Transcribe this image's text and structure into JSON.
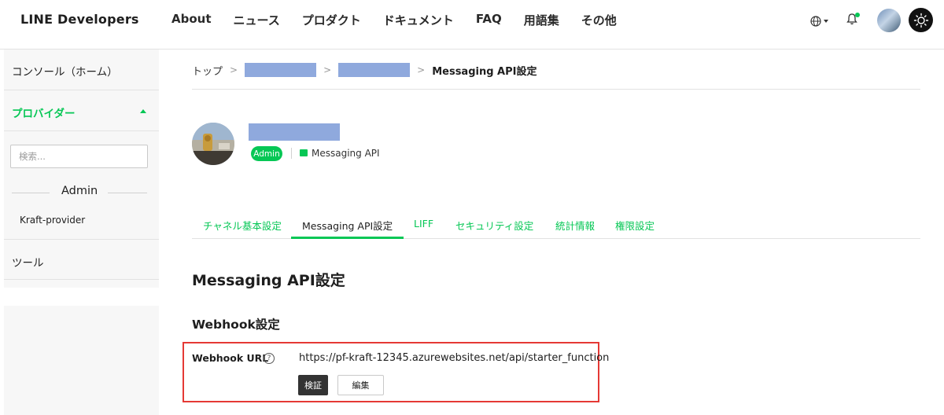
{
  "header": {
    "logo": "LINE Developers",
    "nav": [
      "About",
      "ニュース",
      "プロダクト",
      "ドキュメント",
      "FAQ",
      "用語集",
      "その他"
    ]
  },
  "sidebar": {
    "console": "コンソール（ホーム）",
    "provider": "プロバイダー",
    "search_placeholder": "検索...",
    "admin_label": "Admin",
    "provider_item": "Kraft-provider",
    "tools": "ツール"
  },
  "breadcrumb": {
    "home": "トップ",
    "current": "Messaging API設定"
  },
  "channel": {
    "role_badge": "Admin",
    "type": "Messaging API"
  },
  "tabs": [
    "チャネル基本設定",
    "Messaging API設定",
    "LIFF",
    "セキュリティ設定",
    "統計情報",
    "権限設定"
  ],
  "active_tab": "Messaging API設定",
  "page_heading": "Messaging API設定",
  "webhook": {
    "section_title": "Webhook設定",
    "url_label": "Webhook URL",
    "help_symbol": "?",
    "url_value": "https://pf-kraft-12345.azurewebsites.net/api/starter_function",
    "verify_button": "検証",
    "edit_button": "編集"
  },
  "colors": {
    "brand_green": "#06c755",
    "highlight_red": "#e53935",
    "redaction_blue": "#8fa9dd"
  }
}
